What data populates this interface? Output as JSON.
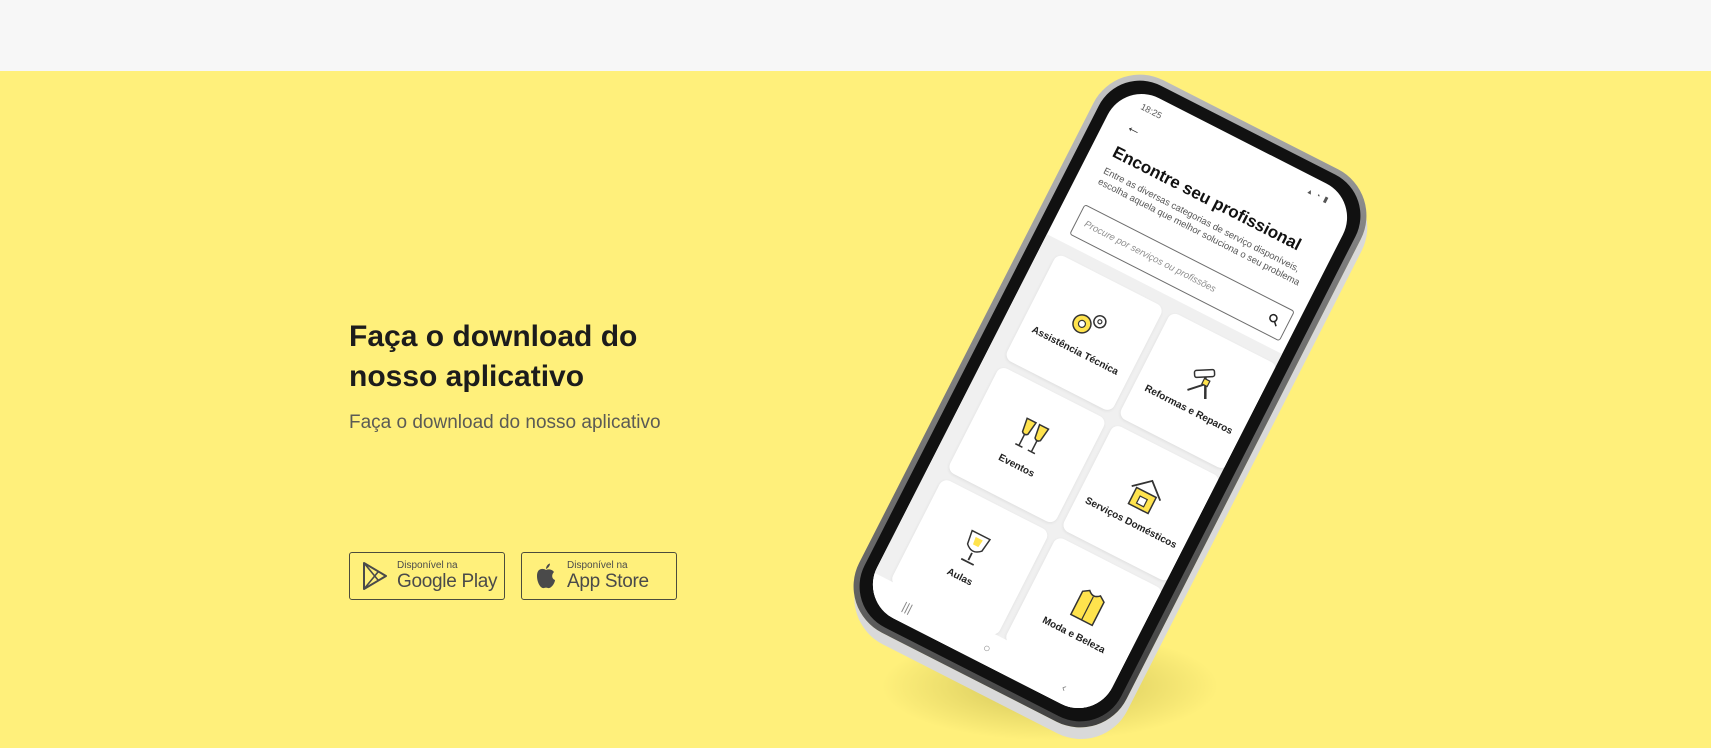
{
  "hero": {
    "headline_line1": "Faça o download do",
    "headline_line2": "nosso aplicativo",
    "subtitle": "Faça o download do nosso aplicativo",
    "background_color": "#fff07b"
  },
  "stores": {
    "google": {
      "small": "Disponível na",
      "big": "Google Play",
      "icon": "google-play-icon"
    },
    "apple": {
      "small": "Disponível na",
      "big": "App Store",
      "icon": "apple-icon"
    }
  },
  "phone_screen": {
    "status_time": "18:25",
    "title": "Encontre seu profissional",
    "description": "Entre as diversas categorias de serviço disponíveis, escolha aquela que melhor soluciona o seu problema",
    "search_placeholder": "Procure por serviços ou profissões",
    "categories": [
      {
        "label": "Assistência Técnica",
        "icon": "gears-icon"
      },
      {
        "label": "Reformas e Reparos",
        "icon": "hammer-icon"
      },
      {
        "label": "Eventos",
        "icon": "champagne-icon"
      },
      {
        "label": "Serviços Domésticos",
        "icon": "house-icon"
      },
      {
        "label": "Aulas",
        "icon": "trophy-icon"
      },
      {
        "label": "Moda e Beleza",
        "icon": "clothes-icon"
      }
    ]
  }
}
